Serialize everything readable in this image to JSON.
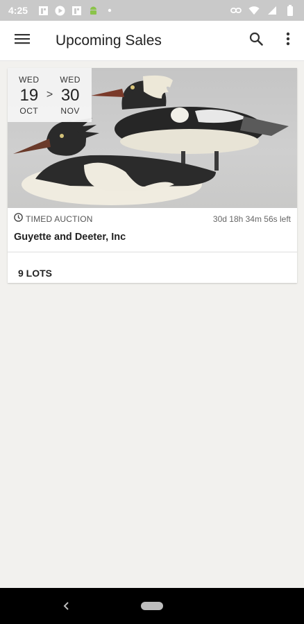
{
  "status_bar": {
    "time": "4:25"
  },
  "app_bar": {
    "title": "Upcoming Sales"
  },
  "sale": {
    "start": {
      "dow": "WED",
      "day": "19",
      "month": "OCT"
    },
    "separator": ">",
    "end": {
      "dow": "WED",
      "day": "30",
      "month": "NOV"
    },
    "type": "TIMED AUCTION",
    "time_left": "30d 18h 34m 56s left",
    "auctioneer": "Guyette and Deeter, Inc",
    "lots": "9 LOTS"
  },
  "colors": {
    "background": "#f2f1ee",
    "status_bar": "#c9c9c9",
    "app_bar": "#ffffff",
    "nav_bar": "#000000"
  }
}
